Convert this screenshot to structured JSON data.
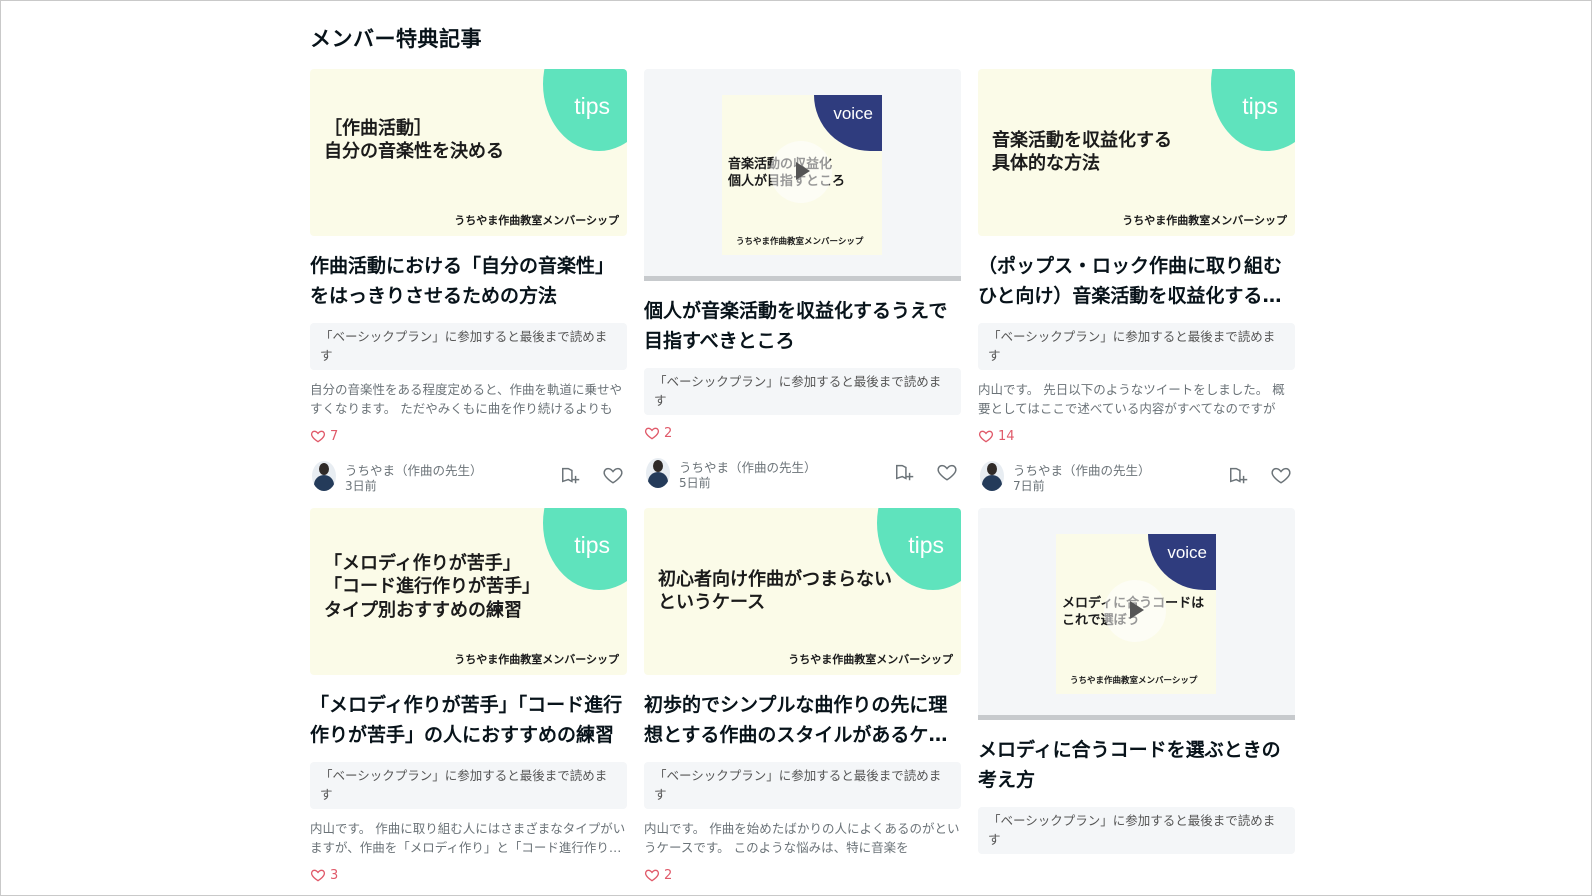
{
  "section": {
    "title": "メンバー特典記事"
  },
  "brand": "うちやま作曲教室メンバーシップ",
  "labels": {
    "tips": "tips",
    "voice": "voice"
  },
  "icons": {
    "like": "heart-outline-icon",
    "magazine": "magazine-add-icon",
    "play": "play-icon"
  },
  "colors": {
    "tips_accent": "#5fe3bd",
    "voice_accent": "#2f3c7e",
    "like": "#e05a6a",
    "thumb_bg": "#fbfbe8"
  },
  "cards": [
    {
      "type": "tips",
      "thumb_text": "［作曲活動］\n自分の音楽性を決める",
      "title": "作曲活動における「自分の音楽性」をはっきりさせるための方法",
      "plan": "「ベーシックプラン」に参加すると最後まで読めます",
      "excerpt": "自分の音楽性をある程度定めると、作曲を軌道に乗せやすくなります。 ただやみくもに曲を作り続けるよりも",
      "likes": "7",
      "author": "うちやま（作曲の先生）",
      "date": "3日前"
    },
    {
      "type": "voice",
      "thumb_text": "音楽活動の収益化\n個人が目指すところ",
      "title": "個人が音楽活動を収益化するうえで目指すべきところ",
      "plan": "「ベーシックプラン」に参加すると最後まで読めます",
      "excerpt": "",
      "likes": "2",
      "author": "うちやま（作曲の先生）",
      "date": "5日前"
    },
    {
      "type": "tips",
      "thumb_text": "音楽活動を収益化する\n具体的な方法",
      "title": "（ポップス・ロック作曲に取り組むひと向け）音楽活動を収益化する具体的な方法",
      "plan": "「ベーシックプラン」に参加すると最後まで読めます",
      "excerpt": "内山です。 先日以下のようなツイートをしました。 概要としてはここで述べている内容がすべてなのですが",
      "likes": "14",
      "author": "うちやま（作曲の先生）",
      "date": "7日前"
    },
    {
      "type": "tips",
      "thumb_text": "「メロディ作りが苦手」\n「コード進行作りが苦手」\n タイプ別おすすめの練習",
      "title": "「メロディ作りが苦手」「コード進行作りが苦手」の人におすすめの練習",
      "plan": "「ベーシックプラン」に参加すると最後まで読めます",
      "excerpt": "内山です。 作曲に取り組む人にはさまざまなタイプがいますが、作曲を「メロディ作り」と「コード進行作り」に",
      "likes": "3",
      "author": "",
      "date": ""
    },
    {
      "type": "tips",
      "thumb_text": "初心者向け作曲がつまらない\nというケース",
      "title": "初歩的でシンプルな曲作りの先に理想とする作曲のスタイルがあるケース",
      "plan": "「ベーシックプラン」に参加すると最後まで読めます",
      "excerpt": "内山です。 作曲を始めたばかりの人によくあるのがというケースです。 このような悩みは、特に音楽を",
      "likes": "2",
      "author": "",
      "date": ""
    },
    {
      "type": "voice",
      "thumb_text": "メロディに合うコードは\nこれで選ぼう",
      "title": "メロディに合うコードを選ぶときの考え方",
      "plan": "「ベーシックプラン」に参加すると最後まで読めます",
      "excerpt": "",
      "likes": "",
      "author": "",
      "date": ""
    }
  ]
}
